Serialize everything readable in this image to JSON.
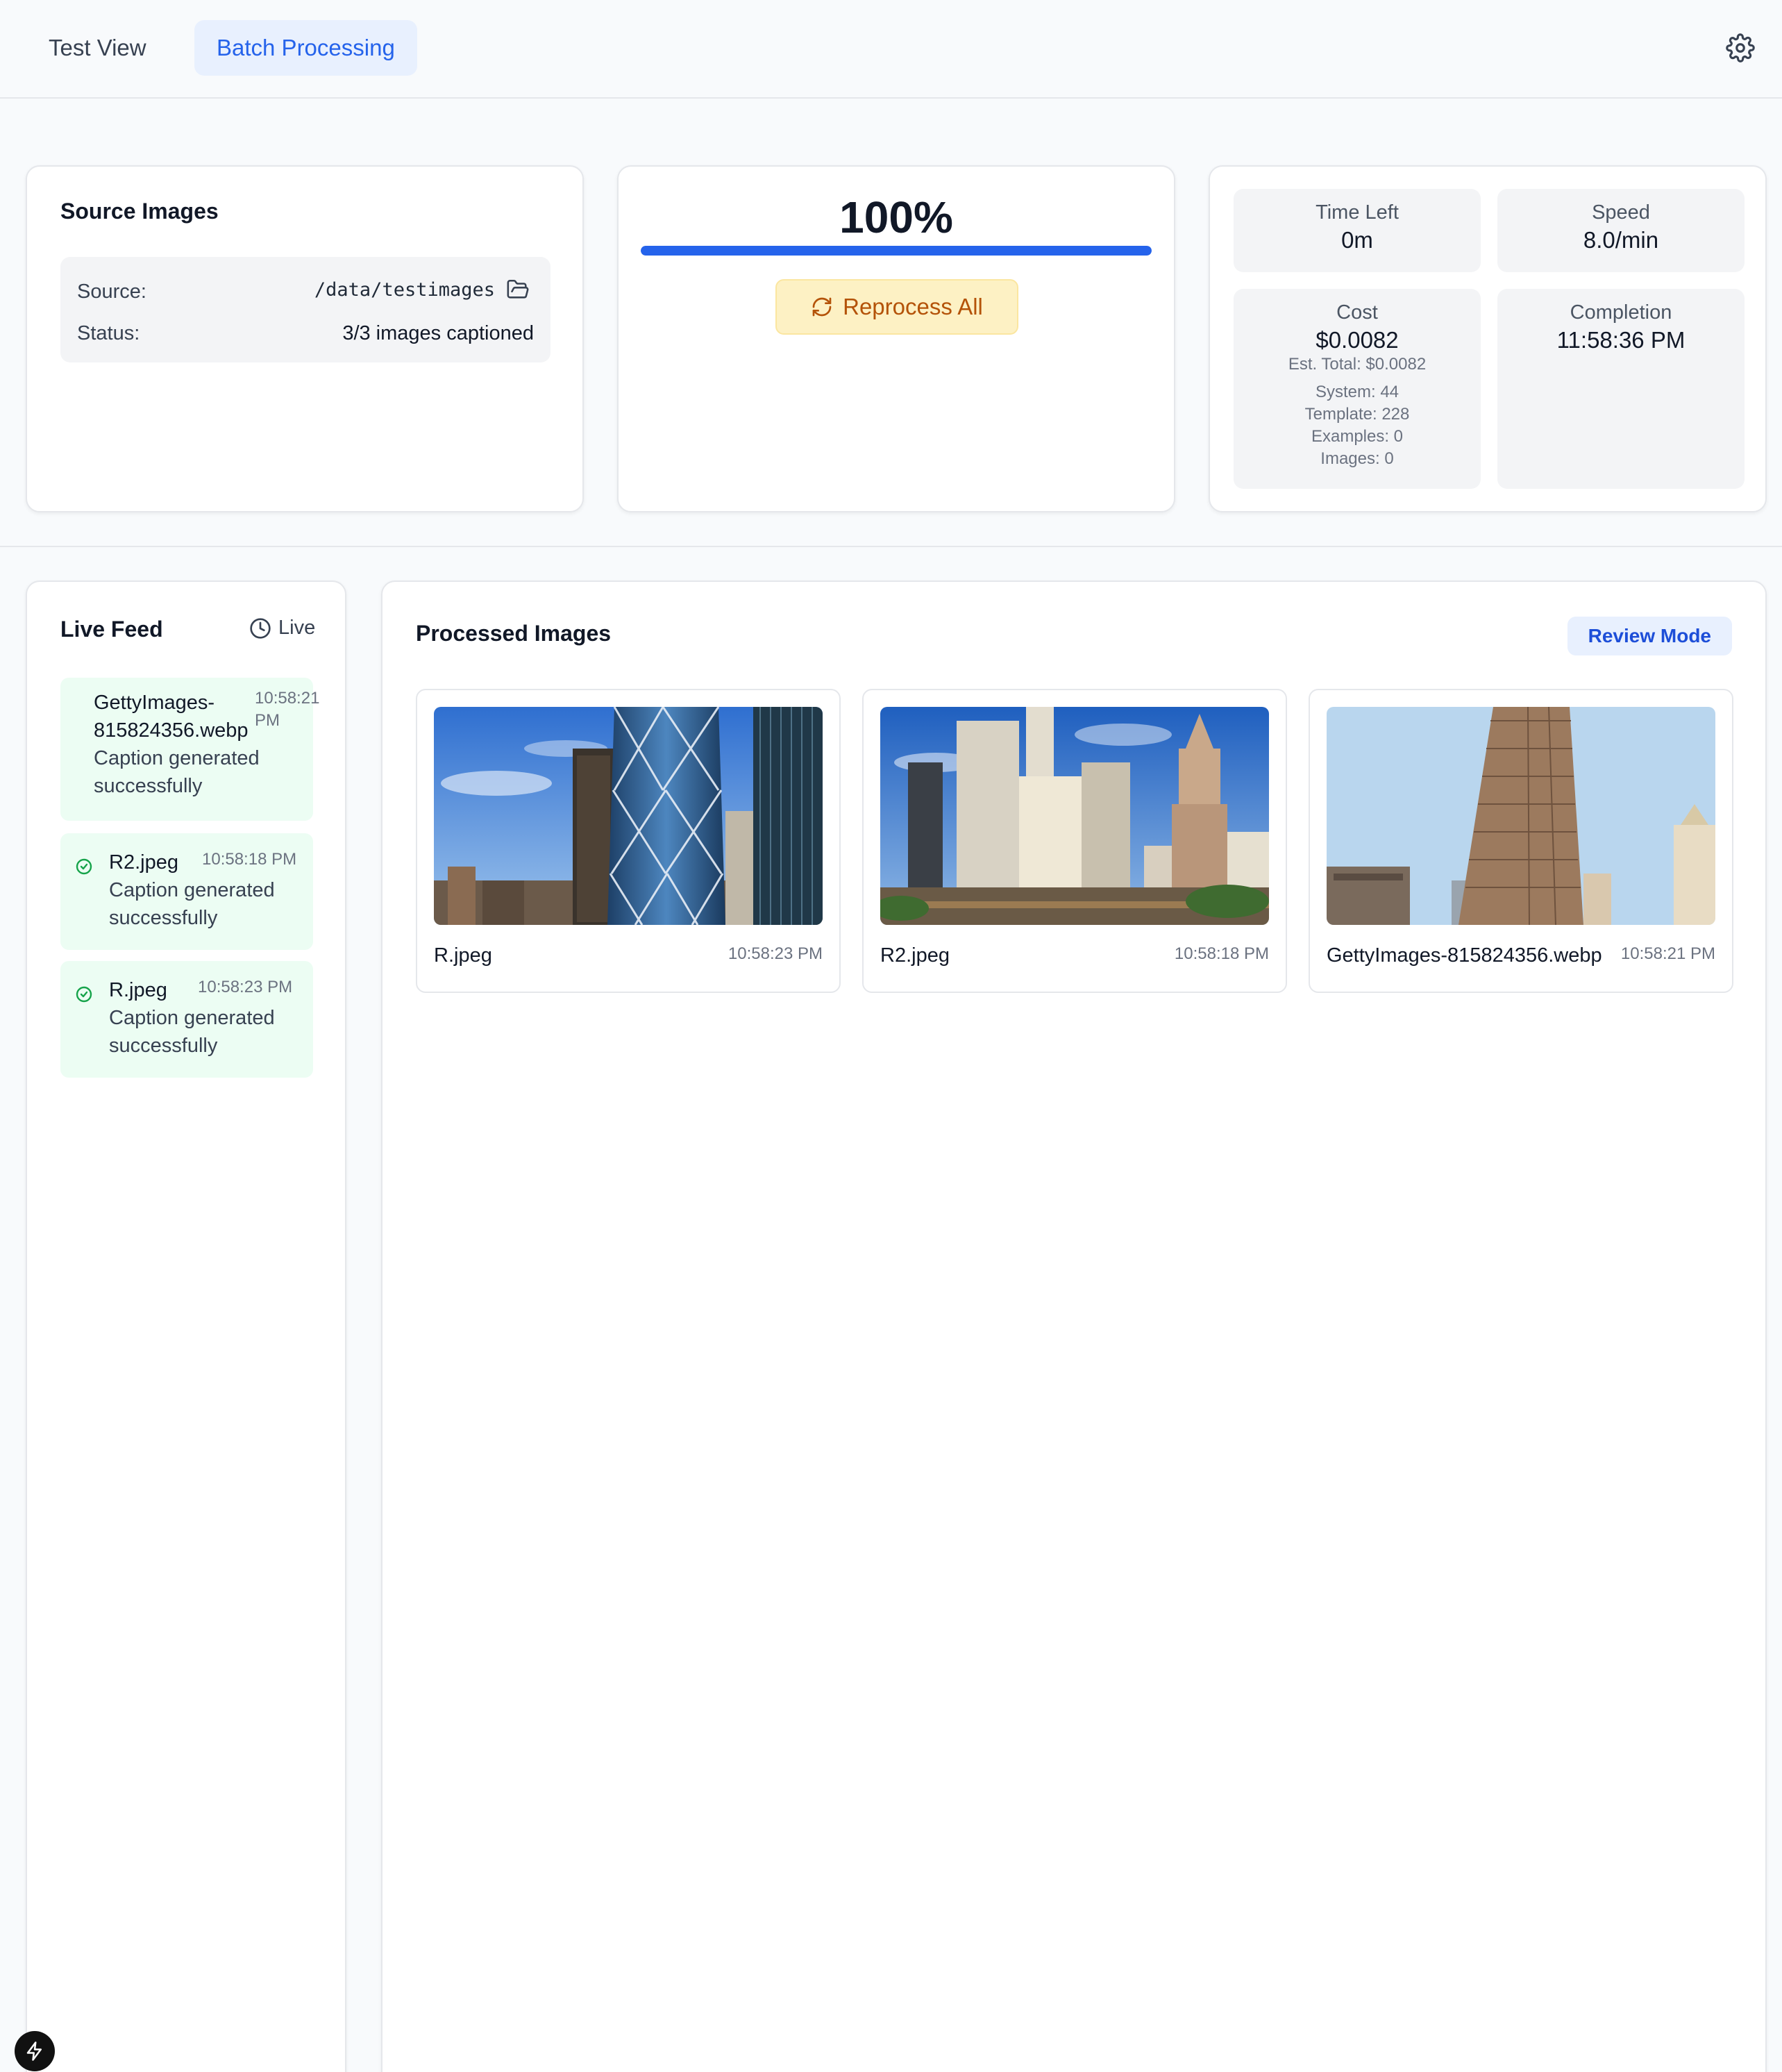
{
  "nav": {
    "tabs": [
      {
        "label": "Test View",
        "active": false
      },
      {
        "label": "Batch Processing",
        "active": true
      }
    ],
    "settings_icon": "gear-icon"
  },
  "source": {
    "title": "Source Images",
    "source_label": "Source:",
    "source_value": "/data/testimages",
    "folder_icon": "folder-open-icon",
    "status_label": "Status:",
    "status_value": "3/3 images captioned"
  },
  "progress": {
    "percent_label": "100%",
    "percent": 100,
    "reprocess_label": "Reprocess All",
    "reprocess_icon": "refresh-icon"
  },
  "stats": {
    "time_left_label": "Time Left",
    "time_left_value": "0m",
    "speed_label": "Speed",
    "speed_value": "8.0/min",
    "cost_label": "Cost",
    "cost_value": "$0.0082",
    "est_total": "Est. Total: $0.0082",
    "system": "System: 44",
    "template": "Template: 228",
    "examples": "Examples: 0",
    "images": "Images: 0",
    "completion_label": "Completion",
    "completion_value": "11:58:36 PM"
  },
  "live_feed": {
    "title": "Live Feed",
    "live_label": "Live",
    "items": [
      {
        "name_line1": "GettyImages-",
        "name_line2": "815824356.webp",
        "time_line1": "10:58:21",
        "time_line2": "PM",
        "msg_line1": "Caption generated",
        "msg_line2": "successfully",
        "status": "success"
      },
      {
        "name": "R2.jpeg",
        "time": "10:58:18 PM",
        "msg_line1": "Caption generated",
        "msg_line2": "successfully",
        "status": "success"
      },
      {
        "name": "R.jpeg",
        "time": "10:58:23 PM",
        "msg_line1": "Caption generated",
        "msg_line2": "successfully",
        "status": "success"
      }
    ]
  },
  "processed": {
    "title": "Processed Images",
    "review_label": "Review Mode",
    "images": [
      {
        "name": "R.jpeg",
        "time": "10:58:23 PM"
      },
      {
        "name": "R2.jpeg",
        "time": "10:58:18 PM"
      },
      {
        "name": "GettyImages-815824356.webp",
        "time": "10:58:21 PM"
      }
    ]
  },
  "colors": {
    "accent": "#2563eb",
    "success_bg": "#ecfdf3",
    "warning_bg": "#fdf1c4",
    "warning_text": "#b45309"
  }
}
